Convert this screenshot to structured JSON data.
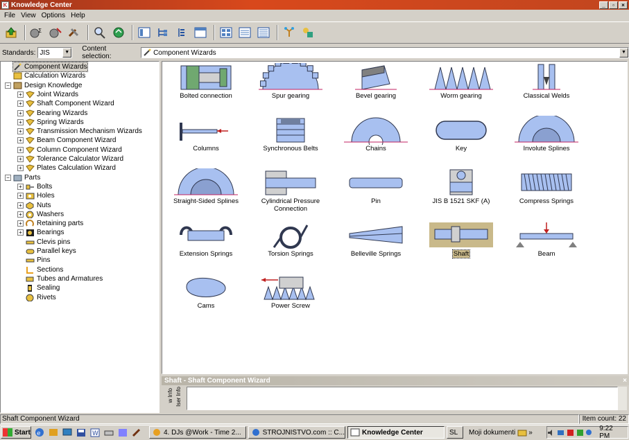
{
  "window": {
    "title": "Knowledge Center"
  },
  "menu": [
    "File",
    "View",
    "Options",
    "Help"
  ],
  "stdbar": {
    "standards_label": "Standards:",
    "standards_value": "JIS",
    "content_label": "Content selection:",
    "content_value": "Component Wizards"
  },
  "tree": [
    {
      "label": "Component Wizards",
      "indent": 1,
      "exp": "",
      "icon": "wizard-icon"
    },
    {
      "label": "Calculation Wizards",
      "indent": 1,
      "exp": "",
      "icon": "calc-icon"
    },
    {
      "label": "Design Knowledge",
      "indent": 0,
      "exp": "−",
      "icon": "book-icon"
    },
    {
      "label": "Joint Wizards",
      "indent": 2,
      "exp": "+",
      "icon": "folder-icon"
    },
    {
      "label": "Shaft Component Wizard",
      "indent": 2,
      "exp": "+",
      "icon": "folder-icon"
    },
    {
      "label": "Bearing Wizards",
      "indent": 2,
      "exp": "+",
      "icon": "folder-icon"
    },
    {
      "label": "Spring Wizards",
      "indent": 2,
      "exp": "+",
      "icon": "folder-icon"
    },
    {
      "label": "Transmission Mechanism Wizards",
      "indent": 2,
      "exp": "+",
      "icon": "folder-icon"
    },
    {
      "label": "Beam Component Wizard",
      "indent": 2,
      "exp": "+",
      "icon": "folder-icon"
    },
    {
      "label": "Column Component Wizard",
      "indent": 2,
      "exp": "+",
      "icon": "folder-icon"
    },
    {
      "label": "Tolerance Calculator Wizard",
      "indent": 2,
      "exp": "+",
      "icon": "folder-icon"
    },
    {
      "label": "Plates Calculation Wizard",
      "indent": 2,
      "exp": "+",
      "icon": "folder-icon"
    },
    {
      "label": "Parts",
      "indent": 0,
      "exp": "−",
      "icon": "parts-icon"
    },
    {
      "label": "Bolts",
      "indent": 2,
      "exp": "+",
      "icon": "bolt-icon"
    },
    {
      "label": "Holes",
      "indent": 2,
      "exp": "+",
      "icon": "hole-icon"
    },
    {
      "label": "Nuts",
      "indent": 2,
      "exp": "+",
      "icon": "nut-icon"
    },
    {
      "label": "Washers",
      "indent": 2,
      "exp": "+",
      "icon": "washer-icon"
    },
    {
      "label": "Retaining parts",
      "indent": 2,
      "exp": "+",
      "icon": "retaining-icon"
    },
    {
      "label": "Bearings",
      "indent": 2,
      "exp": "+",
      "icon": "bearing-icon"
    },
    {
      "label": "Clevis pins",
      "indent": 2,
      "exp": "",
      "icon": "pin-icon"
    },
    {
      "label": "Parallel keys",
      "indent": 2,
      "exp": "",
      "icon": "key-icon"
    },
    {
      "label": "Pins",
      "indent": 2,
      "exp": "",
      "icon": "pin-icon"
    },
    {
      "label": "Sections",
      "indent": 2,
      "exp": "",
      "icon": "section-icon"
    },
    {
      "label": "Tubes and Armatures",
      "indent": 2,
      "exp": "",
      "icon": "tube-icon"
    },
    {
      "label": "Sealing",
      "indent": 2,
      "exp": "",
      "icon": "seal-icon"
    },
    {
      "label": "Rivets",
      "indent": 2,
      "exp": "",
      "icon": "rivet-icon"
    }
  ],
  "wizards": [
    {
      "label": "Bolted connection",
      "icon": "bolted-connection-icon"
    },
    {
      "label": "Spur gearing",
      "icon": "spur-gear-icon"
    },
    {
      "label": "Bevel gearing",
      "icon": "bevel-gear-icon"
    },
    {
      "label": "Worm gearing",
      "icon": "worm-gear-icon"
    },
    {
      "label": "Classical Welds",
      "icon": "weld-icon"
    },
    {
      "label": "Columns",
      "icon": "column-icon"
    },
    {
      "label": "Synchronous Belts",
      "icon": "belt-icon"
    },
    {
      "label": "Chains",
      "icon": "chain-icon"
    },
    {
      "label": "Key",
      "icon": "key-icon"
    },
    {
      "label": "Involute Splines",
      "icon": "involute-spline-icon"
    },
    {
      "label": "Straight-Sided Splines",
      "icon": "straight-spline-icon"
    },
    {
      "label": "Cylindrical Pressure Connection",
      "icon": "pressure-connection-icon"
    },
    {
      "label": "Pin",
      "icon": "pin-icon"
    },
    {
      "label": "JIS B 1521 SKF (A)",
      "icon": "bearing-icon"
    },
    {
      "label": "Compress Springs",
      "icon": "compression-spring-icon"
    },
    {
      "label": "Extension Springs",
      "icon": "extension-spring-icon"
    },
    {
      "label": "Torsion Springs",
      "icon": "torsion-spring-icon"
    },
    {
      "label": "Belleville Springs",
      "icon": "belleville-spring-icon"
    },
    {
      "label": "Shaft",
      "icon": "shaft-icon",
      "selected": true
    },
    {
      "label": "Beam",
      "icon": "beam-icon"
    },
    {
      "label": "Cams",
      "icon": "cam-icon"
    },
    {
      "label": "Power Screw",
      "icon": "power-screw-icon"
    }
  ],
  "panel": {
    "title": "Shaft - Shaft Component Wizard",
    "tab1": "w Info",
    "tab2": "Iser Info"
  },
  "status": {
    "left": "Shaft Component Wizard",
    "right": "Item count: 22"
  },
  "taskbar": {
    "start": "Start",
    "buttons": [
      "4. DJs @Work - Time 2...",
      "STROJNISTVO.com :: C...",
      "Knowledge Center",
      "SL"
    ],
    "tray_folder": "Moji dokumenti",
    "clock": "9:22 PM"
  },
  "colors": {
    "accent": "#a8c0f0",
    "title": "#c2461f"
  }
}
